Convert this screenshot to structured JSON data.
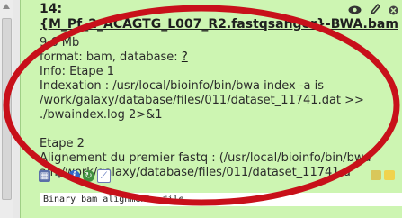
{
  "dataset": {
    "title_line1": "14:",
    "title_line2": "{M_Pf_2_ACAGTG_L007_R2.fastqsanger}-BWA.bam",
    "size": "9.6 Mb",
    "format_line": "format: bam, database: ",
    "database_link": "?",
    "info_lines": [
      "Info: Etape 1",
      "Indexation : /usr/local/bioinfo/bin/bwa index -a is",
      "/work/galaxy/database/files/011/dataset_11741.dat >>",
      "./bwaindex.log 2>&1"
    ],
    "info_lines_2": [
      "Etape 2",
      "Alignement du premier fastq : (/usr/local/bioinfo/bin/bwa",
      "aln /work/galaxy/database/files/011/dataset_11741.d"
    ],
    "peek": "Binary bam alignments file"
  },
  "icons": {
    "header": [
      "eye-icon",
      "pencil-icon",
      "delete-icon"
    ],
    "toolbar": [
      "visualize-icon",
      "dropdown-arrow-icon",
      "info-icon",
      "rerun-icon",
      "chart-icon",
      "tag-icon",
      "annotation-icon"
    ]
  },
  "colors": {
    "panel_bg": "#cdf5b2",
    "annotation_ellipse": "#c8101a"
  }
}
